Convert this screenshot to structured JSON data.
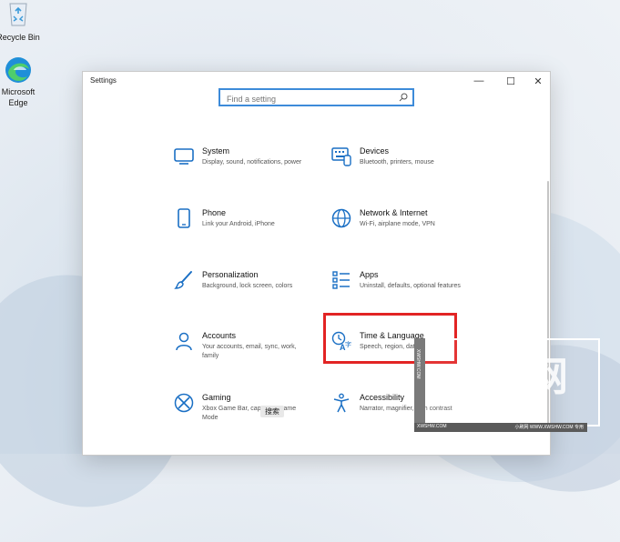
{
  "desktop": {
    "icons": [
      {
        "name": "recycle-bin",
        "label": "Recycle Bin"
      },
      {
        "name": "microsoft-edge",
        "label_line1": "Microsoft",
        "label_line2": "Edge"
      }
    ]
  },
  "window": {
    "title": "Settings",
    "controls": {
      "minimize": "—",
      "maximize": "☐",
      "close": "✕"
    }
  },
  "search": {
    "placeholder": "Find a setting"
  },
  "tiles": [
    {
      "name": "System",
      "desc": "Display, sound, notifications, power",
      "icon": "monitor-icon"
    },
    {
      "name": "Devices",
      "desc": "Bluetooth, printers, mouse",
      "icon": "keyboard-icon"
    },
    {
      "name": "Phone",
      "desc": "Link your Android, iPhone",
      "icon": "phone-icon"
    },
    {
      "name": "Network & Internet",
      "desc": "Wi-Fi, airplane mode, VPN",
      "icon": "globe-icon"
    },
    {
      "name": "Personalization",
      "desc": "Background, lock screen, colors",
      "icon": "brush-icon"
    },
    {
      "name": "Apps",
      "desc": "Uninstall, defaults, optional features",
      "icon": "apps-list-icon"
    },
    {
      "name": "Accounts",
      "desc": "Your accounts, email, sync, work, family",
      "icon": "person-icon"
    },
    {
      "name": "Time & Language",
      "desc": "Speech, region, date",
      "icon": "time-language-icon"
    },
    {
      "name": "Gaming",
      "desc": "Xbox Game Bar, captures, Game Mode",
      "icon": "xbox-icon"
    },
    {
      "name": "Accessibility",
      "desc": "Narrator, magnifier, high contrast",
      "icon": "accessibility-icon"
    }
  ],
  "taskbar": {
    "search_label": "搜索"
  },
  "watermark": {
    "big": "小刷网",
    "url": "XWSHW.COM",
    "side": "XWSHW.COM",
    "bar_left": "XWSHW.COM",
    "bar_right": "小刷网 WWW.XWSHW.COM 专用"
  },
  "colors": {
    "accent": "#1a6fc4",
    "highlight": "#e22424",
    "search_border": "#3d8bd9"
  }
}
